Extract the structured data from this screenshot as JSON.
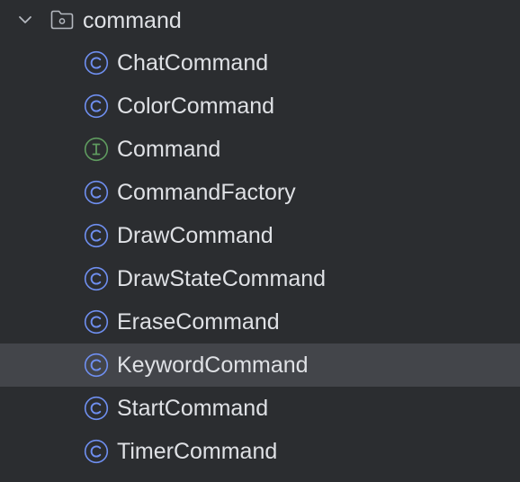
{
  "folder": {
    "name": "command",
    "expanded": true,
    "icon": "package-folder-icon"
  },
  "colors": {
    "background": "#2b2d30",
    "selected_row": "#43454a",
    "text": "#dfe1e5",
    "class_icon": "#6f8ff0",
    "interface_icon": "#5f9b5f"
  },
  "items": [
    {
      "label": "ChatCommand",
      "kind": "class",
      "icon_letter": "C"
    },
    {
      "label": "ColorCommand",
      "kind": "class",
      "icon_letter": "C"
    },
    {
      "label": "Command",
      "kind": "interface",
      "icon_letter": "I"
    },
    {
      "label": "CommandFactory",
      "kind": "class",
      "icon_letter": "C"
    },
    {
      "label": "DrawCommand",
      "kind": "class",
      "icon_letter": "C"
    },
    {
      "label": "DrawStateCommand",
      "kind": "class",
      "icon_letter": "C"
    },
    {
      "label": "EraseCommand",
      "kind": "class",
      "icon_letter": "C"
    },
    {
      "label": "KeywordCommand",
      "kind": "class",
      "icon_letter": "C",
      "selected": true
    },
    {
      "label": "StartCommand",
      "kind": "class",
      "icon_letter": "C"
    },
    {
      "label": "TimerCommand",
      "kind": "class",
      "icon_letter": "C"
    }
  ]
}
